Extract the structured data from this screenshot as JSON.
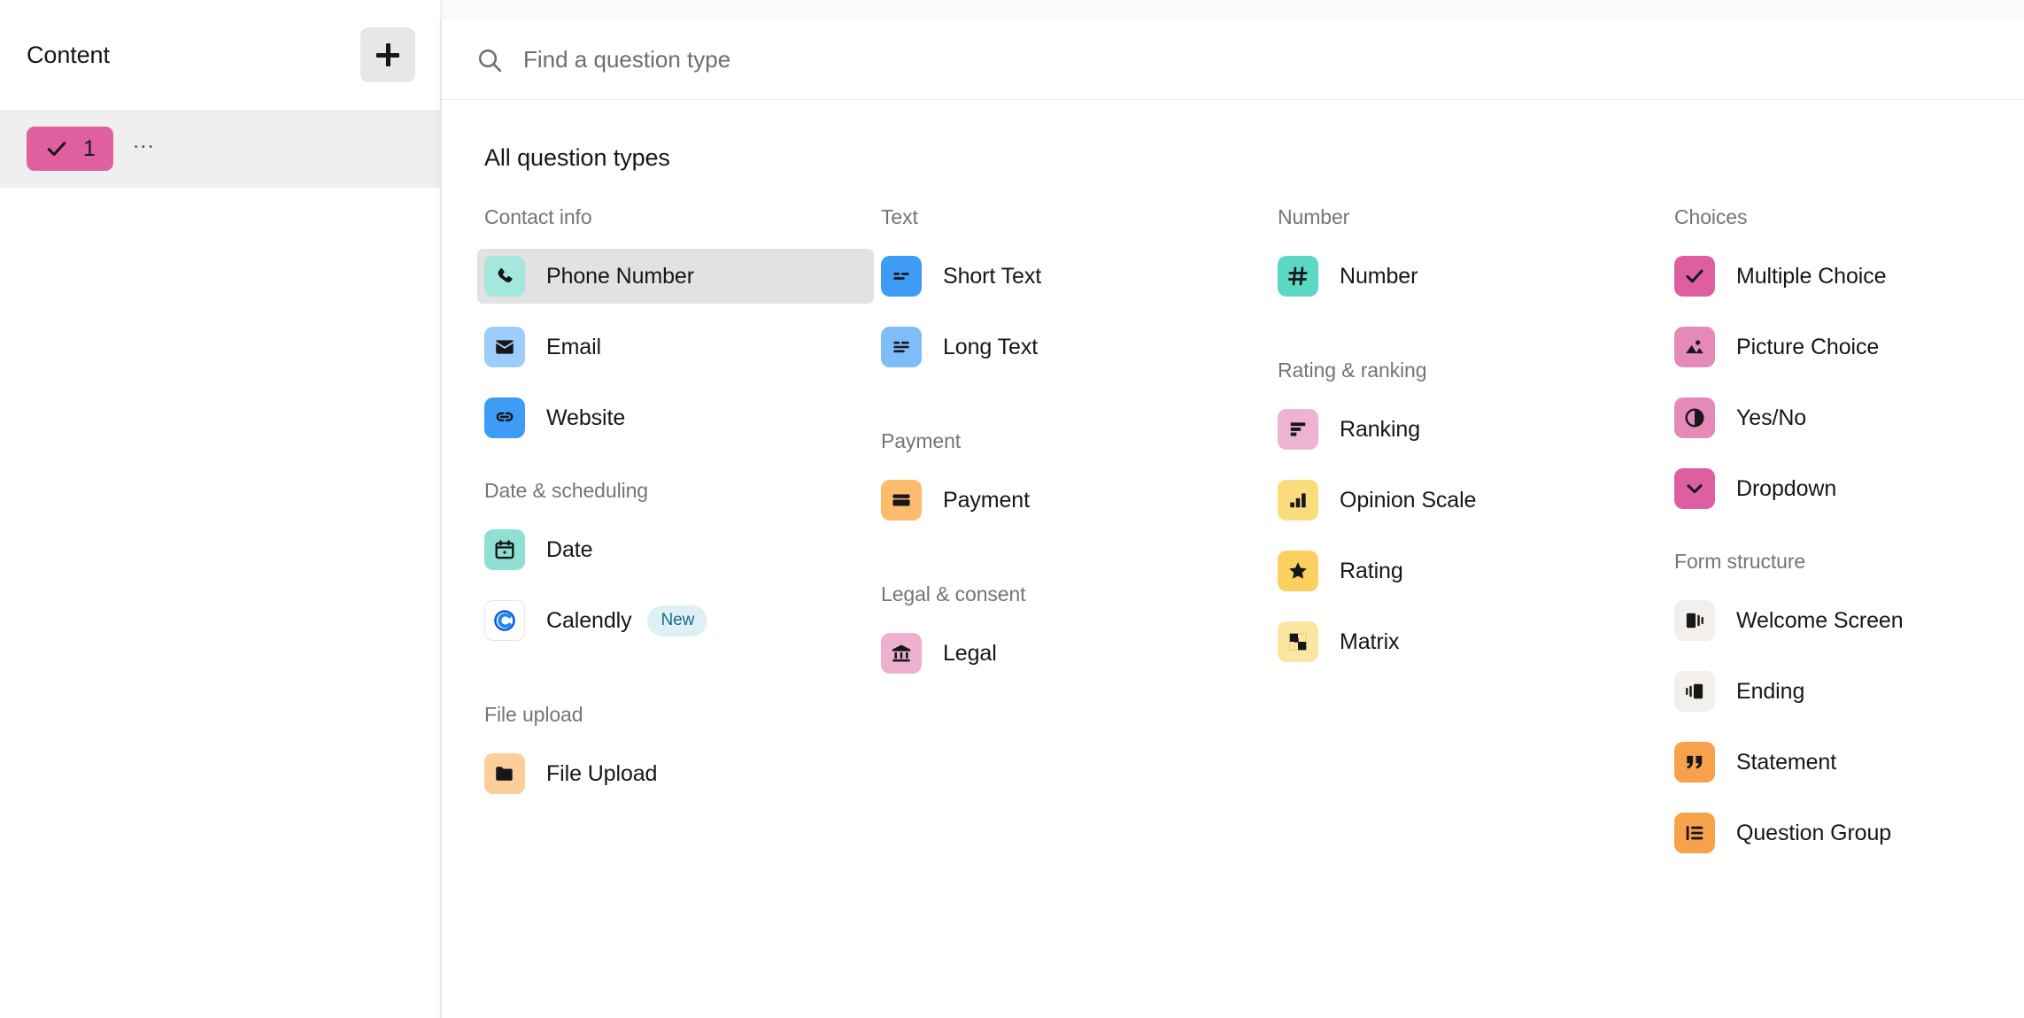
{
  "sidebar": {
    "title": "Content",
    "add_button_label": "+",
    "add_button_icon": "plus-icon",
    "question_item": {
      "number": "1",
      "status_icon": "check-icon",
      "badge_color": "#e0609f",
      "more_label": "..."
    }
  },
  "search": {
    "placeholder": "Find a question type",
    "value": "",
    "icon": "search-icon"
  },
  "panel": {
    "heading": "All question types"
  },
  "columns": [
    {
      "groups": [
        {
          "title": "Contact info",
          "items": [
            {
              "label": "Phone Number",
              "icon": "phone-icon",
              "color": "#a3e8da",
              "selected": true
            },
            {
              "label": "Email",
              "icon": "envelope-icon",
              "color": "#9ccdfb",
              "selected": false
            },
            {
              "label": "Website",
              "icon": "link-icon",
              "color": "#3d9cf5",
              "selected": false
            }
          ]
        },
        {
          "title": "Date & scheduling",
          "items": [
            {
              "label": "Date",
              "icon": "calendar-icon",
              "color": "#8fe0d2",
              "selected": false
            },
            {
              "label": "Calendly",
              "icon": "calendly-icon",
              "color": "#ffffff",
              "selected": false,
              "badge": "New"
            }
          ]
        },
        {
          "title": "File upload",
          "items": [
            {
              "label": "File Upload",
              "icon": "folder-icon",
              "color": "#fbcf9b",
              "selected": false
            }
          ]
        }
      ]
    },
    {
      "groups": [
        {
          "title": "Text",
          "items": [
            {
              "label": "Short Text",
              "icon": "short-text-icon",
              "color": "#3d9cf5",
              "selected": false
            },
            {
              "label": "Long Text",
              "icon": "long-text-icon",
              "color": "#7fbdfa",
              "selected": false
            }
          ]
        },
        {
          "title": "Payment",
          "items": [
            {
              "label": "Payment",
              "icon": "credit-card-icon",
              "color": "#fbbc6e",
              "selected": false
            }
          ]
        },
        {
          "title": "Legal & consent",
          "items": [
            {
              "label": "Legal",
              "icon": "bank-icon",
              "color": "#efb0ce",
              "selected": false
            }
          ]
        }
      ]
    },
    {
      "groups": [
        {
          "title": "Number",
          "items": [
            {
              "label": "Number",
              "icon": "hash-icon",
              "color": "#5bd7c4",
              "selected": false
            }
          ]
        },
        {
          "title": "Rating & ranking",
          "items": [
            {
              "label": "Ranking",
              "icon": "ranking-icon",
              "color": "#eeb3d0",
              "selected": false
            },
            {
              "label": "Opinion Scale",
              "icon": "bar-chart-icon",
              "color": "#fbdc7d",
              "selected": false
            },
            {
              "label": "Rating",
              "icon": "star-icon",
              "color": "#fbcf60",
              "selected": false
            },
            {
              "label": "Matrix",
              "icon": "matrix-icon",
              "color": "#fbe6a1",
              "selected": false
            }
          ]
        }
      ]
    },
    {
      "groups": [
        {
          "title": "Choices",
          "items": [
            {
              "label": "Multiple Choice",
              "icon": "check-icon",
              "color": "#dd5fa0",
              "selected": false
            },
            {
              "label": "Picture Choice",
              "icon": "image-icon",
              "color": "#e58ab8",
              "selected": false
            },
            {
              "label": "Yes/No",
              "icon": "half-circle-icon",
              "color": "#e58ab8",
              "selected": false
            },
            {
              "label": "Dropdown",
              "icon": "chevron-down-icon",
              "color": "#dd5fa0",
              "selected": false
            }
          ]
        },
        {
          "title": "Form structure",
          "items": [
            {
              "label": "Welcome Screen",
              "icon": "welcome-screen-icon",
              "color": "#f3f0eb",
              "selected": false
            },
            {
              "label": "Ending",
              "icon": "ending-icon",
              "color": "#f3f0eb",
              "selected": false
            },
            {
              "label": "Statement",
              "icon": "quote-icon",
              "color": "#f7a14a",
              "selected": false
            },
            {
              "label": "Question Group",
              "icon": "question-group-icon",
              "color": "#f7a14a",
              "selected": false
            }
          ]
        }
      ]
    }
  ]
}
